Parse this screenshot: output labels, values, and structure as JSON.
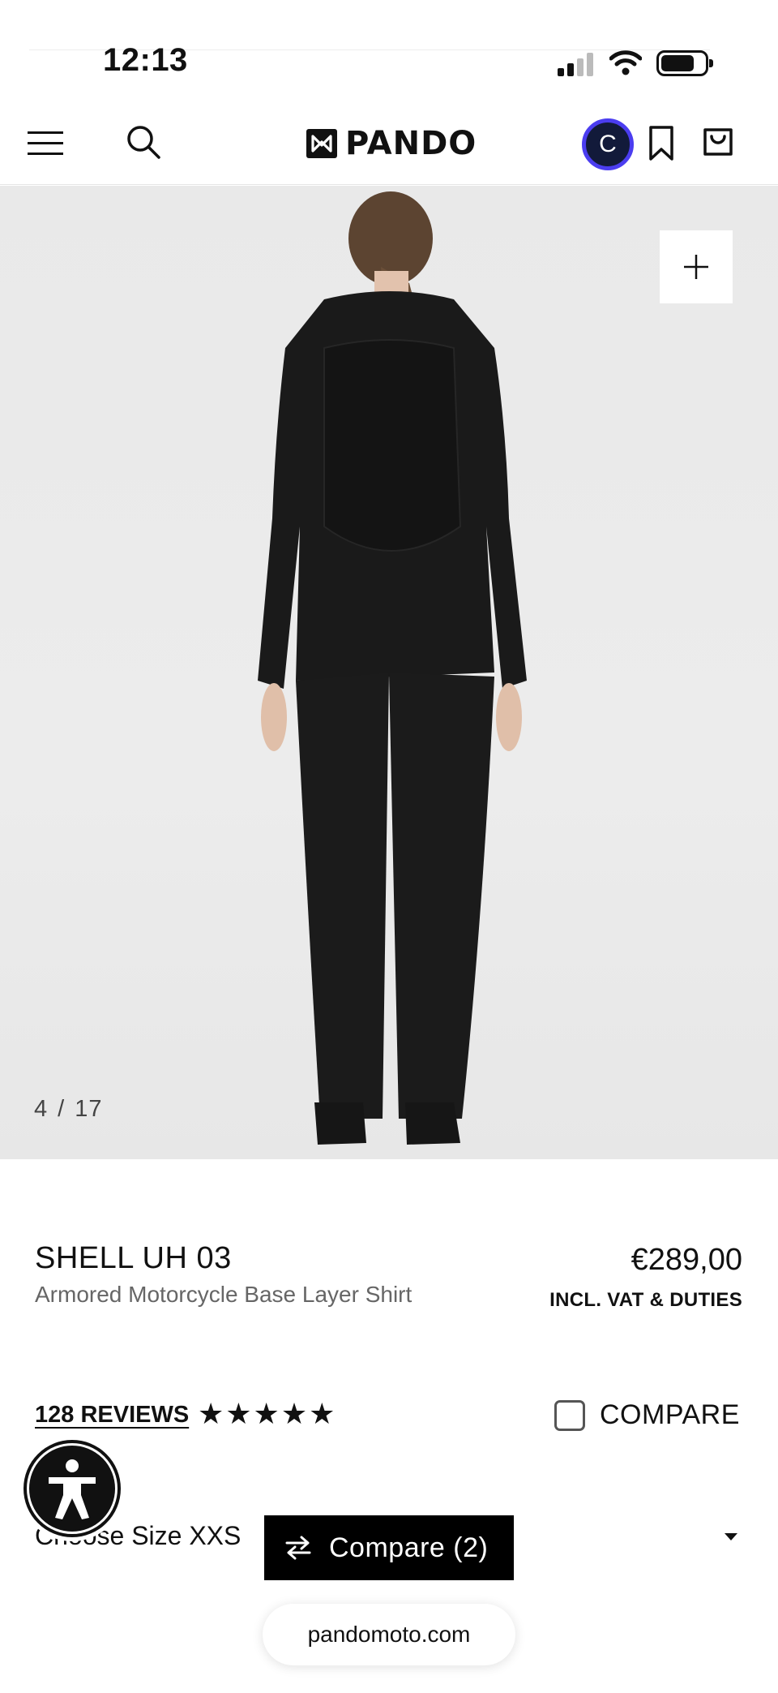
{
  "status_bar": {
    "time": "12:13"
  },
  "header": {
    "brand": "PANDO",
    "avatar_initial": "C"
  },
  "gallery": {
    "current": "4",
    "separator": "/",
    "total": "17"
  },
  "product": {
    "name": "SHELL UH 03",
    "subtitle": "Armored Motorcycle Base Layer Shirt",
    "price": "€289,00",
    "price_note": "INCL. VAT & DUTIES"
  },
  "reviews": {
    "label": "128 REVIEWS",
    "stars": "★★★★★",
    "rating": 5
  },
  "compare": {
    "checkbox_label": "COMPARE",
    "checked": false,
    "bar_label": "Compare (2)"
  },
  "size": {
    "label": "Choose Size",
    "selected": "XXS"
  },
  "browser": {
    "url": "pandomoto.com"
  },
  "colors": {
    "accent_avatar_ring": "#4b3df0",
    "avatar_bg": "#121a3a",
    "compare_bar_bg": "#000000",
    "hero_bg": "#ebebeb"
  },
  "icons": [
    "menu-icon",
    "search-icon",
    "pando-logo-icon",
    "bookmark-icon",
    "shopping-bag-icon",
    "plus-icon",
    "accessibility-icon",
    "compare-arrows-icon",
    "caret-down-icon"
  ]
}
